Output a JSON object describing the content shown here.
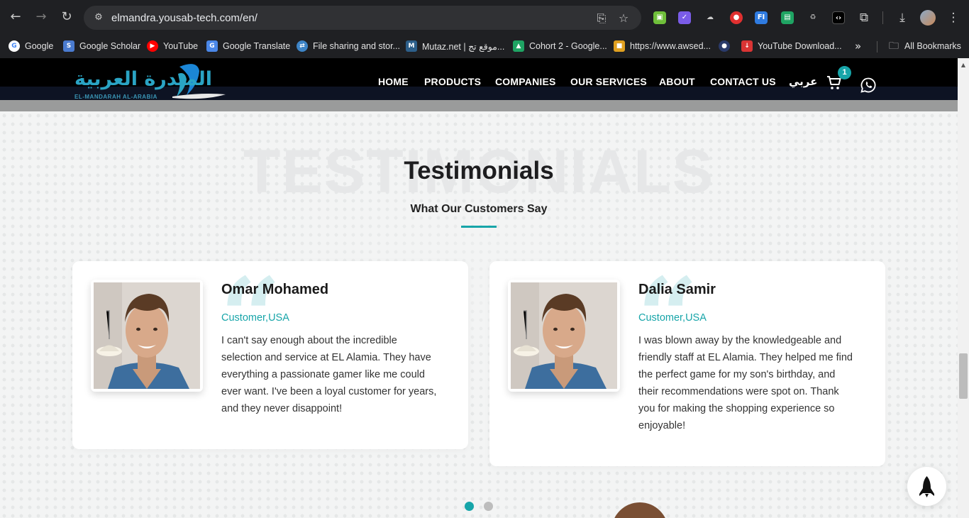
{
  "browser": {
    "url": "elmandra.yousab-tech.com/en/",
    "bookmarks": [
      {
        "label": "Google",
        "color": "#4285f4",
        "glyph": "G"
      },
      {
        "label": "Google Scholar",
        "color": "#4a7bd0",
        "glyph": "S"
      },
      {
        "label": "YouTube",
        "color": "#ff0000",
        "glyph": "▶"
      },
      {
        "label": "Google Translate",
        "color": "#4a87e8",
        "glyph": "G"
      },
      {
        "label": "File sharing and stor...",
        "color": "#3d84c6",
        "glyph": "⇄"
      },
      {
        "label": "Mutaz.net | موقع تج...",
        "color": "#2d5f8a",
        "glyph": "M"
      },
      {
        "label": "Cohort 2 - Google...",
        "color": "#1fa463",
        "glyph": "▲"
      },
      {
        "label": "https://www.awsed...",
        "color": "#e0a020",
        "glyph": "■"
      },
      {
        "label": "",
        "color": "#2a3a6a",
        "glyph": "●"
      },
      {
        "label": "YouTube Download...",
        "color": "#d93434",
        "glyph": "↓"
      }
    ],
    "more_bookmarks_icon": "chevron-double-right-icon",
    "all_bookmarks_label": "All Bookmarks"
  },
  "header": {
    "logo_arabic": "المندرة العربية",
    "logo_english": "EL-MANDARAH AL-ARABIA",
    "nav": [
      "HOME",
      "PRODUCTS",
      "COMPANIES",
      "OUR SERVICES",
      "ABOUT",
      "CONTACT US"
    ],
    "language_label": "عربي",
    "cart_count": "1",
    "accent_color": "#17a5a9"
  },
  "testimonials": {
    "background_word": "TESTIMONIALS",
    "title": "Testimonials",
    "subtitle": "What Our Customers Say",
    "cards": [
      {
        "name": "Omar Mohamed",
        "role": "Customer,USA",
        "text": "I can't say enough about the incredible selection and service at EL Alamia. They have everything a passionate gamer like me could ever want. I've been a loyal customer for years, and they never disappoint!"
      },
      {
        "name": "Dalia Samir",
        "role": "Customer,USA",
        "text": "I was blown away by the knowledgeable and friendly staff at EL Alamia. They helped me find the perfect game for my son's birthday, and their recommendations were spot on. Thank you for making the shopping experience so enjoyable!"
      }
    ],
    "pagination": {
      "pages": 2,
      "active": 1
    }
  },
  "floating": {
    "icon": "rocket-icon"
  }
}
